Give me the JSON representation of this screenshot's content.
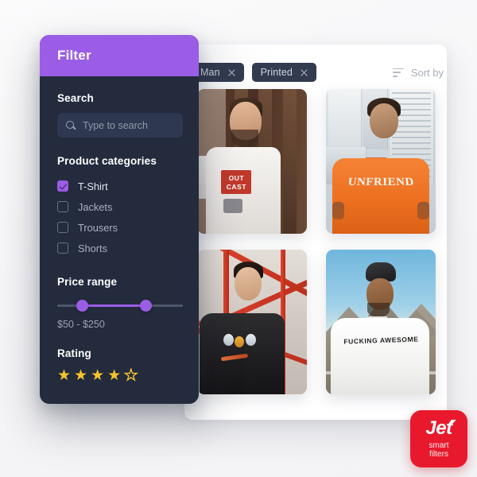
{
  "filter_panel": {
    "title": "Filter",
    "search": {
      "label": "Search",
      "placeholder": "Type to search",
      "value": "",
      "icon": "search-icon"
    },
    "categories": {
      "label": "Product categories",
      "items": [
        {
          "label": "T-Shirt",
          "checked": true
        },
        {
          "label": "Jackets",
          "checked": false
        },
        {
          "label": "Trousers",
          "checked": false
        },
        {
          "label": "Shorts",
          "checked": false
        }
      ]
    },
    "price_range": {
      "label": "Price range",
      "value_text": "$50 - $250",
      "min_label": "$50",
      "max_label": "$250"
    },
    "rating": {
      "label": "Rating",
      "value": 4,
      "max": 5,
      "filled_glyph": "★",
      "empty_glyph": "★"
    },
    "accent_color": "#9b5de5",
    "panel_color": "#232b3d"
  },
  "toolbar": {
    "chips": [
      {
        "label": "Man",
        "remove_icon": "close-icon"
      },
      {
        "label": "Printed",
        "remove_icon": "close-icon"
      }
    ],
    "sort": {
      "label": "Sort by",
      "icon": "sort-lines-icon"
    }
  },
  "products": [
    {
      "alt": "Man in white OUTCAST print t-shirt",
      "print_line1": "OUT",
      "print_line2": "CAST"
    },
    {
      "alt": "Man in orange UNFRIEND t-shirt",
      "print_text": "UNFRIEND"
    },
    {
      "alt": "Young man in black graphic t-shirt",
      "print_text": ""
    },
    {
      "alt": "Man in white FUCKING AWESOME t-shirt",
      "print_text": "FUCKING AWESOME"
    }
  ],
  "logo": {
    "word": "Jet",
    "sub_line1": "smart",
    "sub_line2": "filters",
    "color": "#e8192c"
  }
}
